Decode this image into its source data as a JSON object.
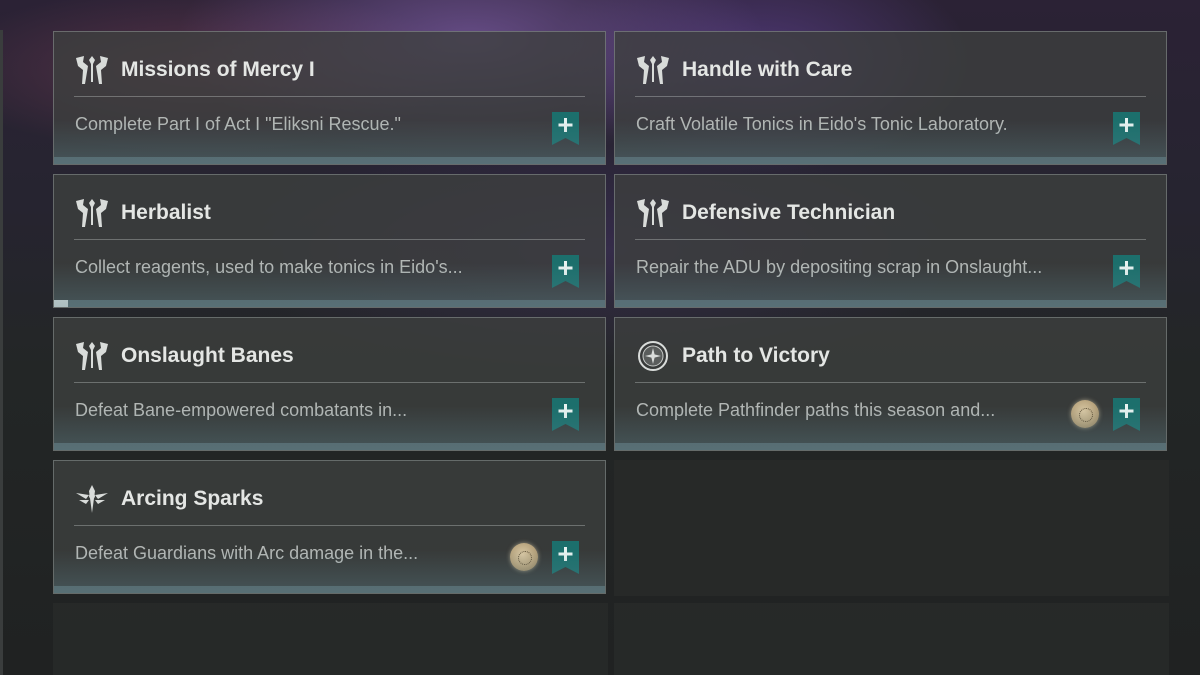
{
  "cards": [
    {
      "title": "Missions of Mercy I",
      "description": "Complete Part I of Act I \"Eliksni Rescue.\"",
      "icon": "eliksni-house-icon",
      "has_reward": false
    },
    {
      "title": "Handle with Care",
      "description": "Craft Volatile Tonics in Eido's Tonic Laboratory.",
      "icon": "eliksni-house-icon",
      "has_reward": false
    },
    {
      "title": "Herbalist",
      "description": "Collect reagents, used to make tonics in Eido's...",
      "icon": "eliksni-house-icon",
      "has_reward": false,
      "progress": 0.03
    },
    {
      "title": "Defensive Technician",
      "description": "Repair the ADU by depositing scrap in Onslaught...",
      "icon": "eliksni-house-icon",
      "has_reward": false
    },
    {
      "title": "Onslaught Banes",
      "description": "Defeat Bane-empowered combatants in...",
      "icon": "eliksni-house-icon",
      "has_reward": false
    },
    {
      "title": "Path to Victory",
      "description": "Complete Pathfinder paths this season and...",
      "icon": "pathfinder-emblem-icon",
      "has_reward": true
    },
    {
      "title": "Arcing Sparks",
      "description": "Defeat Guardians with Arc damage in the...",
      "icon": "crucible-emblem-icon",
      "has_reward": true
    }
  ],
  "colors": {
    "track_button": "#1c6f6c",
    "track_plus": "#e8f3f1",
    "text_title": "#e4e6e4",
    "text_desc": "#b3b7b5"
  }
}
